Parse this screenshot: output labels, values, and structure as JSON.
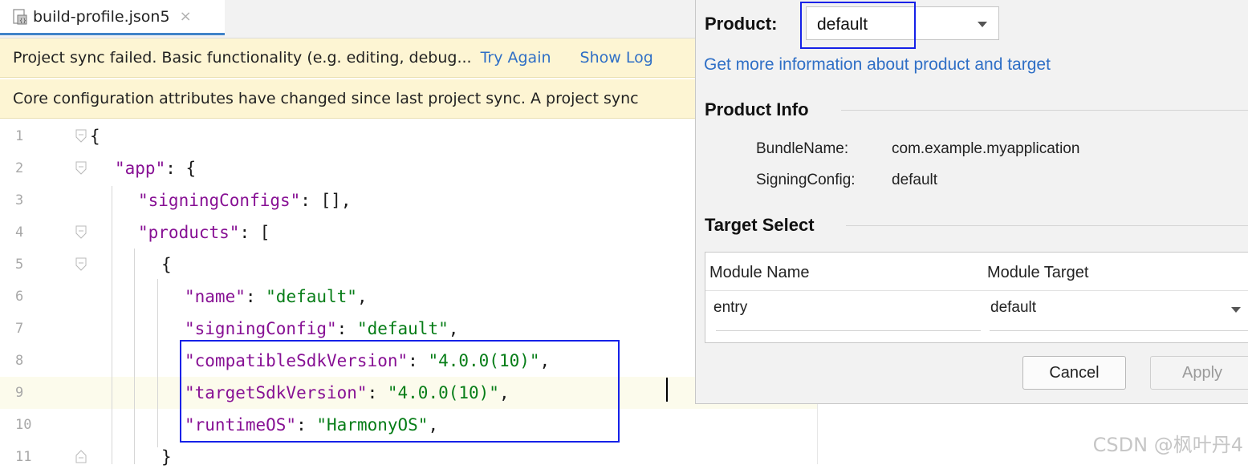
{
  "editor": {
    "tab": {
      "filename": "build-profile.json5",
      "close": "×",
      "icon": "json-file-icon"
    },
    "banner_sync_failed": {
      "text": "Project sync failed. Basic functionality (e.g. editing, debug... ",
      "try_again": "Try Again",
      "show_log": "Show Log"
    },
    "banner_config_changed": {
      "text": "Core configuration attributes have changed since last project sync. A project sync"
    },
    "lines": [
      {
        "num": "1",
        "text": "{"
      },
      {
        "num": "2",
        "key": "\"app\"",
        "rest": ": {"
      },
      {
        "num": "3",
        "key": "\"signingConfigs\"",
        "rest": ": [],"
      },
      {
        "num": "4",
        "key": "\"products\"",
        "rest": ": ["
      },
      {
        "num": "5",
        "text": "{"
      },
      {
        "num": "6",
        "key": "\"name\"",
        "sep": ": ",
        "str": "\"default\"",
        "tail": ","
      },
      {
        "num": "7",
        "key": "\"signingConfig\"",
        "sep": ": ",
        "str": "\"default\"",
        "tail": ","
      },
      {
        "num": "8",
        "key": "\"compatibleSdkVersion\"",
        "sep": ": ",
        "str": "\"4.0.0(10)\"",
        "tail": ","
      },
      {
        "num": "9",
        "key": "\"targetSdkVersion\"",
        "sep": ": ",
        "str": "\"4.0.0(10)\"",
        "tail": ","
      },
      {
        "num": "10",
        "key": "\"runtimeOS\"",
        "sep": ": ",
        "str": "\"HarmonyOS\"",
        "tail": ","
      },
      {
        "num": "11",
        "text": "}"
      }
    ]
  },
  "dialog": {
    "product_label": "Product:",
    "product_value": "default",
    "info_link": "Get more information about product and target",
    "product_info_title": "Product Info",
    "bundle_name_label": "BundleName:",
    "bundle_name_value": "com.example.myapplication",
    "signing_config_label": "SigningConfig:",
    "signing_config_value": "default",
    "target_select_title": "Target Select",
    "table": {
      "headers": [
        "Module Name",
        "Module Target"
      ],
      "rows": [
        {
          "module": "entry",
          "target": "default"
        }
      ]
    },
    "buttons": {
      "cancel": "Cancel",
      "apply": "Apply"
    }
  },
  "watermark": "CSDN @枫叶丹4",
  "colors": {
    "highlight_box": "#1521e8",
    "link": "#2f6fc6",
    "banner_bg": "#fdf5d3",
    "key": "#871094",
    "string": "#067d17"
  }
}
